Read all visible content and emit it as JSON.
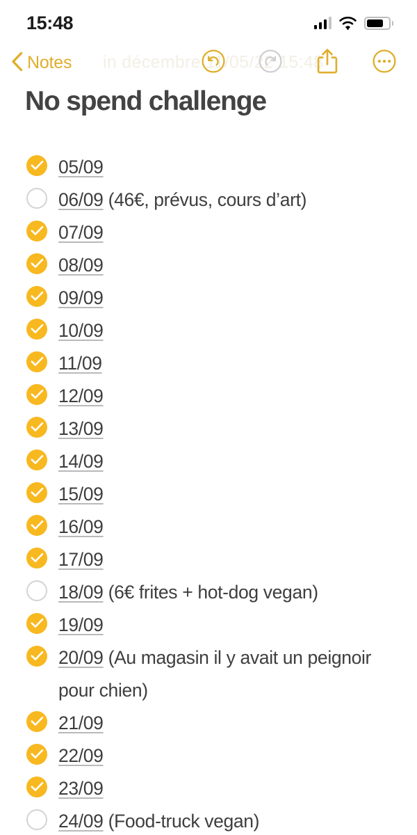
{
  "status_bar": {
    "time": "15:48",
    "signal_icon": "cellular-signal-icon",
    "signal_bars_filled": 3,
    "signal_bars_total": 4,
    "wifi_icon": "wifi-icon",
    "battery_icon": "battery-icon",
    "battery_level_pct": 78
  },
  "nav_bar": {
    "back_label": "Notes",
    "back_icon": "chevron-left-icon",
    "ghost_watermark": "in décembre 11/05/22 15:48",
    "actions": [
      {
        "name": "undo-button",
        "icon": "undo-circle-icon",
        "enabled": true,
        "color": "#dfae2c"
      },
      {
        "name": "redo-button",
        "icon": "redo-circle-icon",
        "enabled": false,
        "color": "#cfcfd1"
      },
      {
        "name": "share-button",
        "icon": "share-up-icon",
        "enabled": true,
        "color": "#dfae2c"
      },
      {
        "name": "more-button",
        "icon": "ellipsis-circle-icon",
        "enabled": true,
        "color": "#dfae2c"
      }
    ]
  },
  "note": {
    "title": "No spend challenge",
    "accent_color": "#f8b81f",
    "text_color": "#3e3e40",
    "items": [
      {
        "checked": true,
        "date": "05/09",
        "extra": ""
      },
      {
        "checked": false,
        "date": "06/09",
        "extra": " (46€, prévus, cours d’art)"
      },
      {
        "checked": true,
        "date": "07/09",
        "extra": ""
      },
      {
        "checked": true,
        "date": "08/09",
        "extra": ""
      },
      {
        "checked": true,
        "date": "09/09",
        "extra": ""
      },
      {
        "checked": true,
        "date": "10/09",
        "extra": ""
      },
      {
        "checked": true,
        "date": "11/09",
        "extra": ""
      },
      {
        "checked": true,
        "date": "12/09",
        "extra": ""
      },
      {
        "checked": true,
        "date": "13/09",
        "extra": ""
      },
      {
        "checked": true,
        "date": "14/09",
        "extra": ""
      },
      {
        "checked": true,
        "date": "15/09",
        "extra": ""
      },
      {
        "checked": true,
        "date": "16/09",
        "extra": ""
      },
      {
        "checked": true,
        "date": "17/09",
        "extra": ""
      },
      {
        "checked": false,
        "date": "18/09",
        "extra": " (6€ frites + hot-dog vegan)"
      },
      {
        "checked": true,
        "date": "19/09",
        "extra": ""
      },
      {
        "checked": true,
        "date": "20/09",
        "extra": " (Au magasin il y avait un peignoir pour chien)"
      },
      {
        "checked": true,
        "date": "21/09",
        "extra": ""
      },
      {
        "checked": true,
        "date": "22/09",
        "extra": ""
      },
      {
        "checked": true,
        "date": "23/09",
        "extra": ""
      },
      {
        "checked": false,
        "date": "24/09",
        "extra": " (Food-truck vegan)"
      }
    ]
  }
}
